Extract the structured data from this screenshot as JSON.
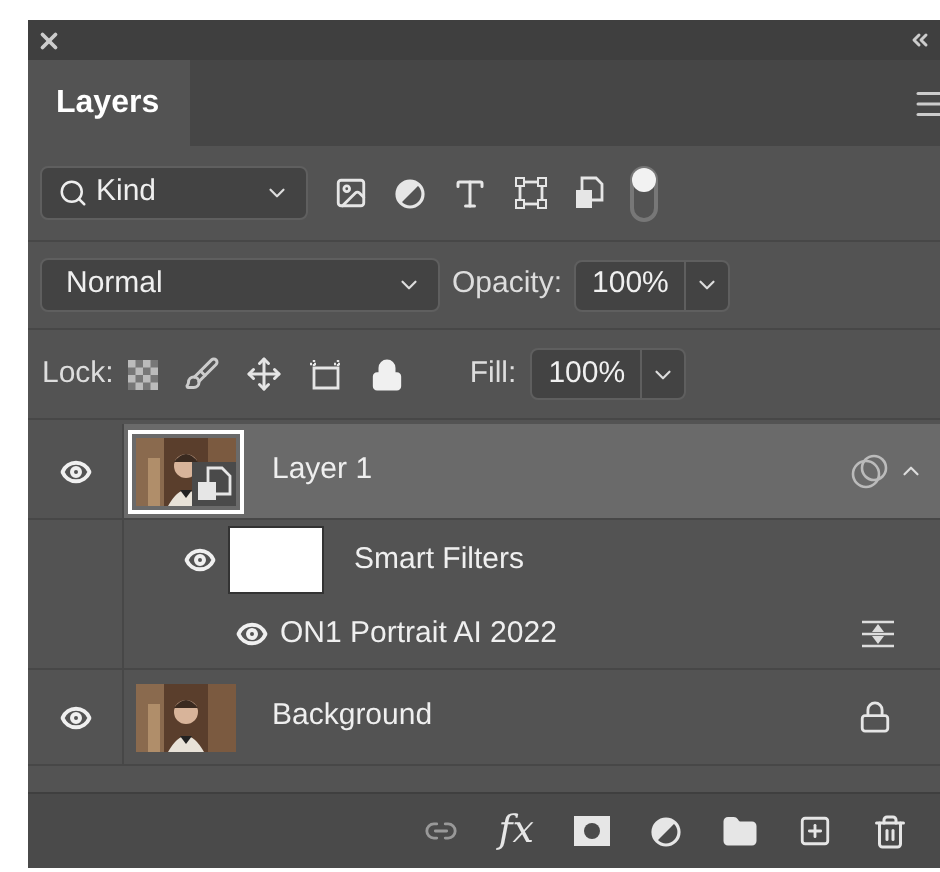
{
  "panel": {
    "tab": {
      "label": "Layers",
      "selected": true
    }
  },
  "filter": {
    "kind": "Kind",
    "on": true
  },
  "blend": {
    "mode": "Normal",
    "opacity_label": "Opacity:",
    "opacity": "100%"
  },
  "lock": {
    "label": "Lock:",
    "fill_label": "Fill:",
    "fill": "100%"
  },
  "layers": [
    {
      "name": "Layer 1",
      "kind": "smart_object",
      "visible": true,
      "selected": true,
      "expanded": true,
      "children": [
        {
          "name": "Smart Filters",
          "visible": true,
          "children": [
            {
              "name": "ON1 Portrait AI 2022",
              "visible": true
            }
          ]
        }
      ]
    },
    {
      "name": "Background",
      "visible": true,
      "selected": false,
      "locked": true
    }
  ],
  "footer": {
    "fx": "fx"
  }
}
